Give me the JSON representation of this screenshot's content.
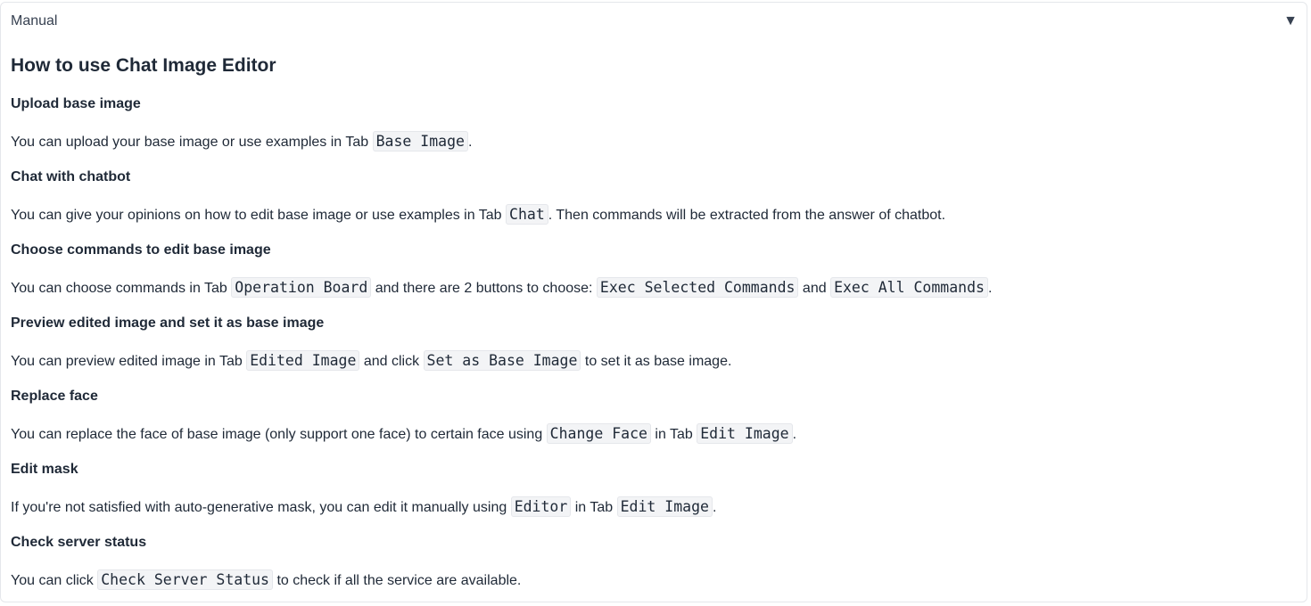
{
  "accordion": {
    "label": "Manual",
    "toggle_icon": "triangle-down-icon",
    "toggle_glyph": "▼"
  },
  "manual": {
    "title": "How to use Chat Image Editor",
    "sections": [
      {
        "heading": "Upload base image",
        "t1": "You can upload your base image or use examples in Tab ",
        "c1": "Base Image",
        "t2": "."
      },
      {
        "heading": "Chat with chatbot",
        "t1": "You can give your opinions on how to edit base image or use examples in Tab ",
        "c1": "Chat",
        "t2": ". Then commands will be extracted from the answer of chatbot."
      },
      {
        "heading": "Choose commands to edit base image",
        "t1": "You can choose commands in Tab ",
        "c1": "Operation Board",
        "t2": " and there are 2 buttons to choose: ",
        "c2": "Exec Selected Commands",
        "t3": " and ",
        "c3": "Exec All Commands",
        "t4": "."
      },
      {
        "heading": "Preview edited image and set it as base image",
        "t1": "You can preview edited image in Tab ",
        "c1": "Edited Image",
        "t2": " and click ",
        "c2": "Set as Base Image",
        "t3": " to set it as base image."
      },
      {
        "heading": "Replace face",
        "t1": "You can replace the face of base image (only support one face) to certain face using ",
        "c1": "Change Face",
        "t2": " in Tab ",
        "c2": "Edit Image",
        "t3": "."
      },
      {
        "heading": "Edit mask",
        "t1": "If you're not satisfied with auto-generative mask, you can edit it manually using ",
        "c1": "Editor",
        "t2": " in Tab ",
        "c2": "Edit Image",
        "t3": "."
      },
      {
        "heading": "Check server status",
        "t1": "You can click ",
        "c1": "Check Server Status",
        "t2": " to check if all the service are available."
      }
    ]
  }
}
